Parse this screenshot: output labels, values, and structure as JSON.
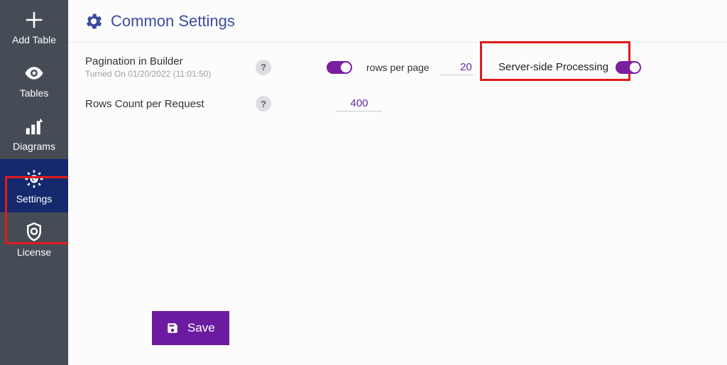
{
  "sidebar": {
    "items": [
      {
        "label": "Add Table",
        "name": "sidebar-item-add-table",
        "icon": "plus-icon"
      },
      {
        "label": "Tables",
        "name": "sidebar-item-tables",
        "icon": "eye-icon"
      },
      {
        "label": "Diagrams",
        "name": "sidebar-item-diagrams",
        "icon": "bars-icon"
      },
      {
        "label": "Settings",
        "name": "sidebar-item-settings",
        "icon": "settings-tool-icon"
      },
      {
        "label": "License",
        "name": "sidebar-item-license",
        "icon": "badge-icon"
      }
    ]
  },
  "header": {
    "title": "Common Settings"
  },
  "settings": {
    "pagination_label": "Pagination in Builder",
    "pagination_sub": "Turned On 01/20/2022 (11:01:50)",
    "rows_per_page_label": "rows per page",
    "rows_per_page_value": "20",
    "ssp_label": "Server-side Processing",
    "rowcount_label": "Rows Count per Request",
    "rowcount_value": "400"
  },
  "buttons": {
    "save_label": "Save"
  },
  "help_glyph": "?",
  "colors": {
    "accent": "#7a1fa2",
    "brand_blue": "#3b4c9b",
    "sidebar_bg": "#454c55",
    "active_bg": "#15296d",
    "highlight": "#e11b1b"
  }
}
